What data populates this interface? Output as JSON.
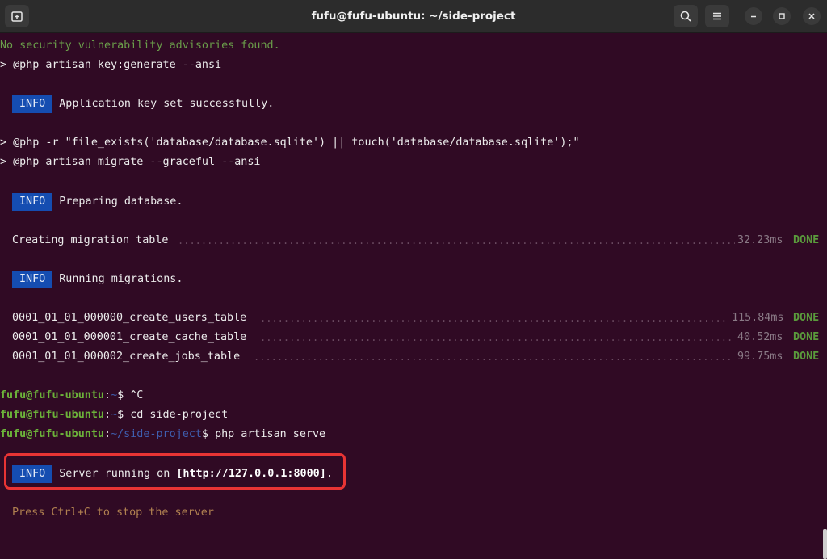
{
  "window": {
    "title": "fufu@fufu-ubuntu: ~/side-project"
  },
  "terminal": {
    "line_security": "No security vulnerability advisories found.",
    "line_keygen": "> @php artisan key:generate --ansi",
    "info_label": "INFO",
    "info_key_msg": "Application key set successfully.",
    "line_touch": "> @php -r \"file_exists('database/database.sqlite') || touch('database/database.sqlite');\"",
    "line_migrate": "> @php artisan migrate --graceful --ansi",
    "info_prepare_msg": "Preparing database.",
    "task_create_table": {
      "name": "Creating migration table",
      "time": "32.23ms",
      "status": "DONE"
    },
    "info_running_msg": "Running migrations.",
    "migrations": [
      {
        "name": "0001_01_01_000000_create_users_table",
        "time": "115.84ms",
        "status": "DONE"
      },
      {
        "name": "0001_01_01_000001_create_cache_table",
        "time": "40.52ms",
        "status": "DONE"
      },
      {
        "name": "0001_01_01_000002_create_jobs_table",
        "time": "99.75ms",
        "status": "DONE"
      }
    ],
    "prompt_user": "fufu@fufu-ubuntu",
    "prompt_colon": ":",
    "prompt_home": "~",
    "prompt_dollar": "$ ",
    "prompt_project_path": "~/side-project",
    "cmd_ctrlc": "^C",
    "cmd_cd": "cd side-project",
    "cmd_serve": "php artisan serve",
    "server_msg_prefix": "Server running on ",
    "server_url": "[http://127.0.0.1:8000]",
    "server_msg_suffix": ".",
    "hint": "Press Ctrl+C to stop the server"
  }
}
